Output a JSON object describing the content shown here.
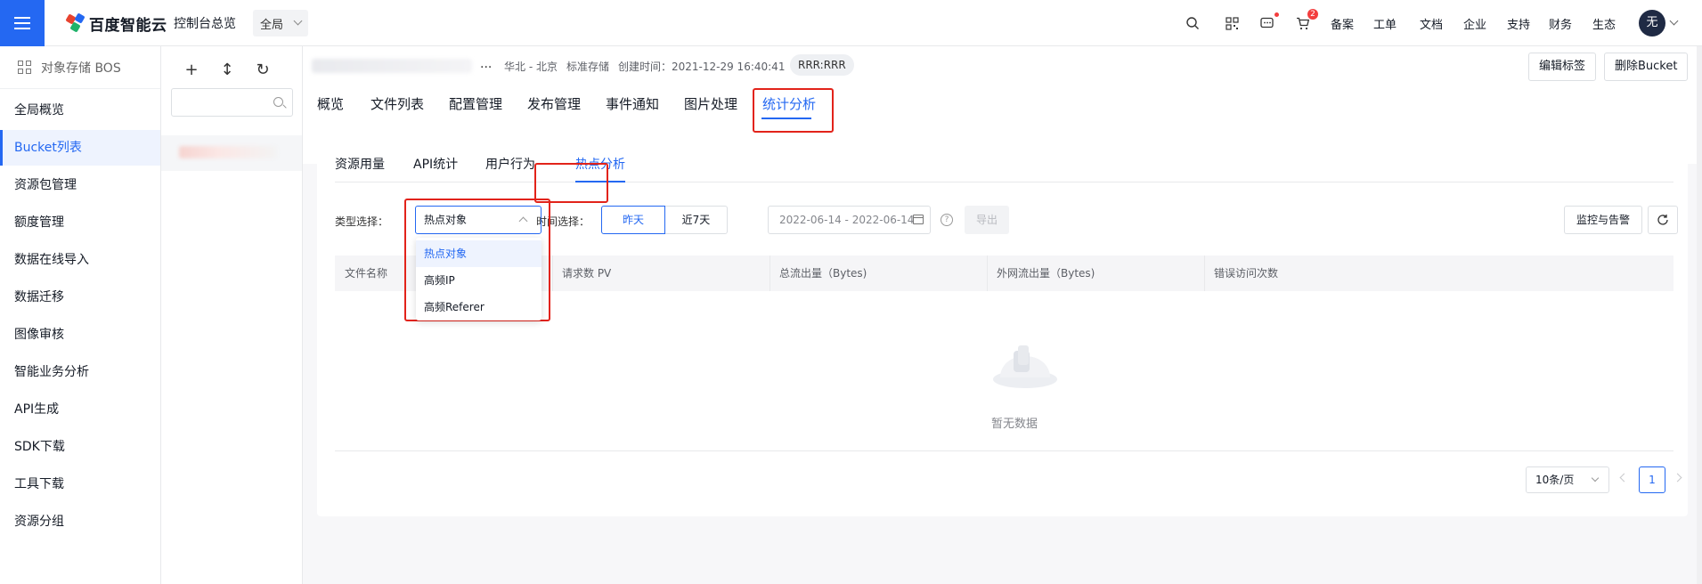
{
  "topbar": {
    "logo_text": "百度智能云",
    "console_home": "控制台总览",
    "region": "全局",
    "icons": [
      "search-icon",
      "qrcode-icon",
      "message-icon",
      "cart-icon"
    ],
    "cart_badge": "2",
    "links": [
      "备案",
      "工单",
      "文档",
      "企业",
      "支持",
      "财务",
      "生态"
    ],
    "avatar_text": "无"
  },
  "leftnav": {
    "title": "对象存储 BOS",
    "items": [
      "全局概览",
      "Bucket列表",
      "资源包管理",
      "额度管理",
      "数据在线导入",
      "数据迁移",
      "图像审核",
      "智能业务分析",
      "API生成",
      "SDK下载",
      "工具下载",
      "资源分组"
    ],
    "active": "Bucket列表"
  },
  "bucketpanel": {
    "tools": [
      "+",
      "↕",
      "↻"
    ]
  },
  "bucket_header": {
    "ellipsis": "...",
    "region": "华北 - 北京",
    "storage_class": "标准存储",
    "created": "创建时间：2021-12-29 16:40:41",
    "tag": "RRR:RRR",
    "edit_tags_label": "编辑标签",
    "delete_bucket_label": "删除Bucket"
  },
  "main_tabs": [
    "概览",
    "文件列表",
    "配置管理",
    "发布管理",
    "事件通知",
    "图片处理",
    "统计分析"
  ],
  "main_tab_active": "统计分析",
  "sub_tabs": [
    "资源用量",
    "API统计",
    "用户行为",
    "热点分析"
  ],
  "sub_tab_active": "热点分析",
  "filters": {
    "type_label": "类型选择：",
    "type_value": "热点对象",
    "type_options": [
      "热点对象",
      "高频IP",
      "高频Referer"
    ],
    "time_label": "时间选择：",
    "time_options": [
      "昨天",
      "近7天"
    ],
    "time_active": "昨天",
    "date_range": "2022-06-14 - 2022-06-14",
    "help": "?",
    "export_label": "导出",
    "monitor_label": "监控与告警"
  },
  "table": {
    "columns": [
      "文件名称",
      "请求数 PV",
      "总流出量（Bytes)",
      "外网流出量（Bytes)",
      "错误访问次数"
    ],
    "empty_text": "暂无数据"
  },
  "pagination": {
    "page_size": "10条/页",
    "current_page": "1"
  },
  "colors": {
    "primary": "#2468f2",
    "highlight_box": "#e2231a"
  }
}
